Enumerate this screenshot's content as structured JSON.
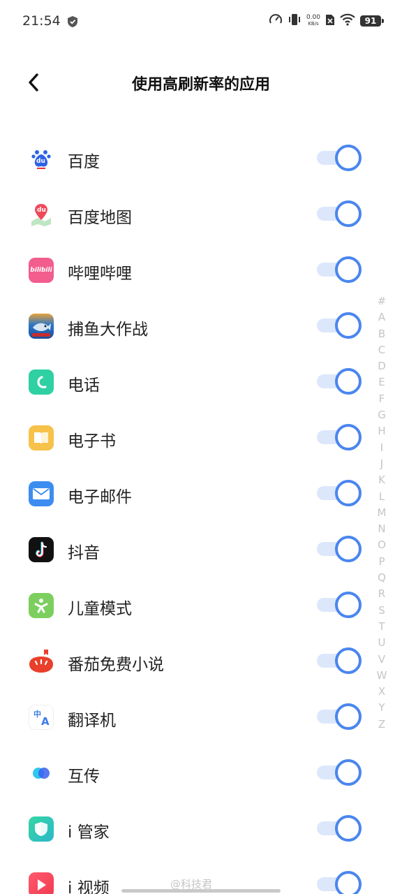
{
  "status_bar": {
    "time": "21:54",
    "network_speed": "0.00",
    "network_unit": "KB/s",
    "battery": "91",
    "icons": [
      "shield-icon",
      "speedometer-icon",
      "vibrate-icon",
      "no-sim-icon",
      "wifi-icon",
      "battery-icon"
    ]
  },
  "header": {
    "title": "使用高刷新率的应用",
    "back_icon": "back-arrow-icon"
  },
  "apps": [
    {
      "name": "百度",
      "icon": "baidu-icon",
      "enabled": true
    },
    {
      "name": "百度地图",
      "icon": "baidu-map-icon",
      "enabled": true
    },
    {
      "name": "哔哩哔哩",
      "icon": "bilibili-icon",
      "enabled": true
    },
    {
      "name": "捕鱼大作战",
      "icon": "fishing-game-icon",
      "enabled": true
    },
    {
      "name": "电话",
      "icon": "phone-icon",
      "enabled": true
    },
    {
      "name": "电子书",
      "icon": "ebook-icon",
      "enabled": true
    },
    {
      "name": "电子邮件",
      "icon": "email-icon",
      "enabled": true
    },
    {
      "name": "抖音",
      "icon": "douyin-icon",
      "enabled": true
    },
    {
      "name": "儿童模式",
      "icon": "kids-mode-icon",
      "enabled": true
    },
    {
      "name": "番茄免费小说",
      "icon": "tomato-novel-icon",
      "enabled": true
    },
    {
      "name": "翻译机",
      "icon": "translator-icon",
      "enabled": true
    },
    {
      "name": "互传",
      "icon": "share-transfer-icon",
      "enabled": true
    },
    {
      "name": "i 管家",
      "icon": "i-manager-icon",
      "enabled": true
    },
    {
      "name": "i 视频",
      "icon": "i-video-icon",
      "enabled": true
    }
  ],
  "alphabet_index": [
    "#",
    "A",
    "B",
    "C",
    "D",
    "E",
    "F",
    "G",
    "H",
    "I",
    "J",
    "K",
    "L",
    "M",
    "N",
    "O",
    "P",
    "Q",
    "R",
    "S",
    "T",
    "U",
    "V",
    "W",
    "X",
    "Y",
    "Z"
  ],
  "watermark": "@科技君",
  "colors": {
    "toggle_on": "#4a86ee",
    "toggle_track": "#dce7fb"
  },
  "icon_text": {
    "baidu": "du",
    "baidu_map": "du",
    "bilibili": "bilibili",
    "translator_top": "中",
    "translator_bottom": "A"
  }
}
